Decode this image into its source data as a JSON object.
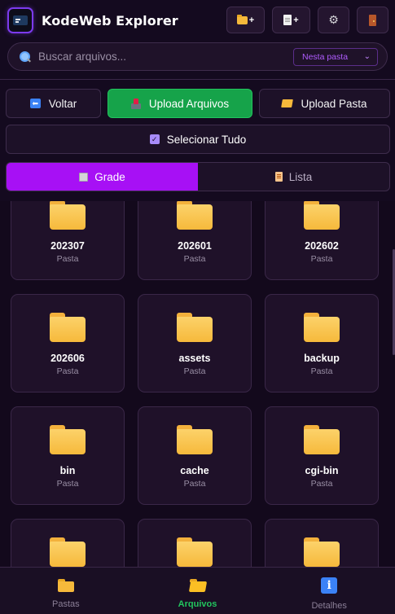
{
  "header": {
    "title": "KodeWeb Explorer",
    "buttons": [
      {
        "name": "new-folder",
        "plus": "+"
      },
      {
        "name": "new-file",
        "plus": "+"
      },
      {
        "name": "settings"
      },
      {
        "name": "logout"
      }
    ]
  },
  "search": {
    "placeholder": "Buscar arquivos...",
    "value": "",
    "scope": "Nesta pasta"
  },
  "actions": {
    "back": "Voltar",
    "upload_files": "Upload Arquivos",
    "upload_folder": "Upload Pasta",
    "select_all": "Selecionar Tudo"
  },
  "view_toggle": {
    "grid": "Grade",
    "list": "Lista",
    "active": "grid"
  },
  "items": [
    {
      "name": "202307",
      "type": "Pasta"
    },
    {
      "name": "202601",
      "type": "Pasta"
    },
    {
      "name": "202602",
      "type": "Pasta"
    },
    {
      "name": "202606",
      "type": "Pasta"
    },
    {
      "name": "assets",
      "type": "Pasta"
    },
    {
      "name": "backup",
      "type": "Pasta"
    },
    {
      "name": "bin",
      "type": "Pasta"
    },
    {
      "name": "cache",
      "type": "Pasta"
    },
    {
      "name": "cgi-bin",
      "type": "Pasta"
    },
    {
      "name": "",
      "type": ""
    },
    {
      "name": "",
      "type": ""
    },
    {
      "name": "",
      "type": ""
    }
  ],
  "bottom_nav": {
    "folders": "Pastas",
    "files": "Arquivos",
    "details": "Detalhes",
    "active": "files"
  },
  "colors": {
    "background": "#140a1f",
    "accent_purple": "#a710f5",
    "upload_green": "#16a34a",
    "active_nav": "#22c55e",
    "folder_yellow": "#f6b93b"
  }
}
